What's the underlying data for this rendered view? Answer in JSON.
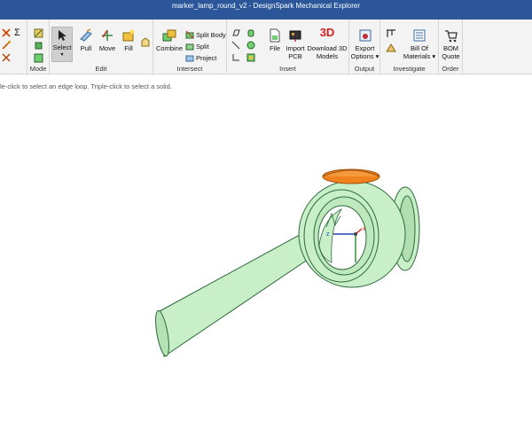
{
  "window": {
    "title": "marker_lamp_round_v2 - DesignSpark Mechanical Explorer"
  },
  "ribbon": {
    "groups": {
      "mode": "Mode",
      "edit": "Edit",
      "intersect": "Intersect",
      "insert": "Insert",
      "output": "Output",
      "investigate": "Investigate",
      "order": "Order"
    },
    "edit": {
      "select": "Select",
      "pull": "Pull",
      "move": "Move",
      "fill": "Fill"
    },
    "intersect": {
      "combine": "Combine",
      "split_body": "Split Body",
      "split": "Split",
      "project": "Project"
    },
    "insert": {
      "file": "File",
      "import_pcb_1": "Import",
      "import_pcb_2": "PCB",
      "download_1": "Download 3D",
      "download_2": "Models",
      "download_badge": "3D"
    },
    "output": {
      "export_1": "Export",
      "export_2": "Options ▾"
    },
    "investigate": {
      "bom_1": "Bill Of",
      "bom_2": "Materials ▾"
    },
    "order": {
      "bom_quote_1": "BOM",
      "bom_quote_2": "Quote"
    },
    "sigma": "Σ"
  },
  "status": {
    "hint": "le-click to select an edge loop. Triple-click to select a solid."
  },
  "viewport": {
    "axis_x": "x",
    "axis_z": "z",
    "colors": {
      "body": "#c8efc8",
      "edge": "#2b6b3a",
      "cap": "#f0821e",
      "axis_x": "#e02020",
      "axis_y": "#2a8a2a",
      "axis_z": "#2040c0"
    }
  }
}
